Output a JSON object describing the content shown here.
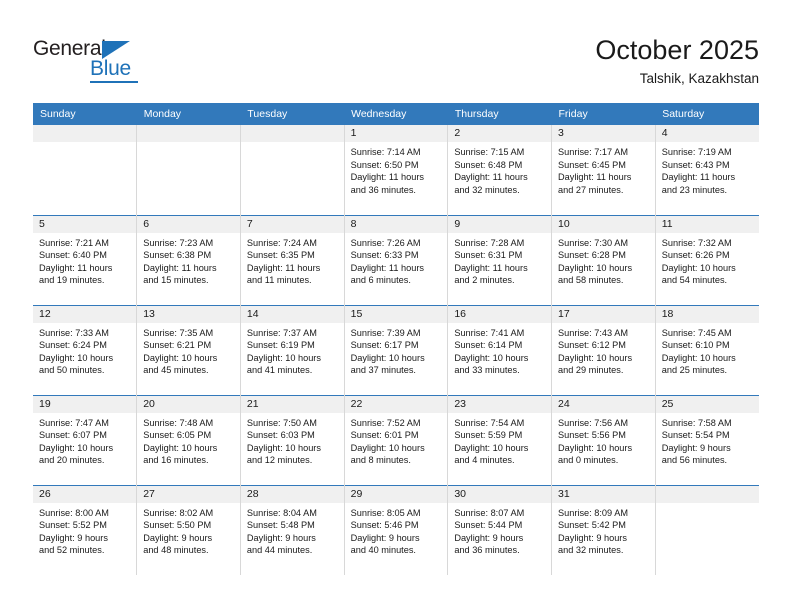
{
  "brand": {
    "name_part1": "General",
    "name_part2": "Blue",
    "accent_color": "#1f72b8"
  },
  "header": {
    "title": "October 2025",
    "subtitle": "Talshik, Kazakhstan",
    "header_bg_color": "#3279bb",
    "daynum_band_color": "#f0f0f0"
  },
  "weekday_headers": [
    "Sunday",
    "Monday",
    "Tuesday",
    "Wednesday",
    "Thursday",
    "Friday",
    "Saturday"
  ],
  "weeks": [
    [
      {
        "day": "",
        "sunrise": "",
        "sunset": "",
        "daylight1": "",
        "daylight2": "",
        "blank": true
      },
      {
        "day": "",
        "sunrise": "",
        "sunset": "",
        "daylight1": "",
        "daylight2": "",
        "blank": true
      },
      {
        "day": "",
        "sunrise": "",
        "sunset": "",
        "daylight1": "",
        "daylight2": "",
        "blank": true
      },
      {
        "day": "1",
        "sunrise": "Sunrise: 7:14 AM",
        "sunset": "Sunset: 6:50 PM",
        "daylight1": "Daylight: 11 hours",
        "daylight2": "and 36 minutes.",
        "blank": false
      },
      {
        "day": "2",
        "sunrise": "Sunrise: 7:15 AM",
        "sunset": "Sunset: 6:48 PM",
        "daylight1": "Daylight: 11 hours",
        "daylight2": "and 32 minutes.",
        "blank": false
      },
      {
        "day": "3",
        "sunrise": "Sunrise: 7:17 AM",
        "sunset": "Sunset: 6:45 PM",
        "daylight1": "Daylight: 11 hours",
        "daylight2": "and 27 minutes.",
        "blank": false
      },
      {
        "day": "4",
        "sunrise": "Sunrise: 7:19 AM",
        "sunset": "Sunset: 6:43 PM",
        "daylight1": "Daylight: 11 hours",
        "daylight2": "and 23 minutes.",
        "blank": false
      }
    ],
    [
      {
        "day": "5",
        "sunrise": "Sunrise: 7:21 AM",
        "sunset": "Sunset: 6:40 PM",
        "daylight1": "Daylight: 11 hours",
        "daylight2": "and 19 minutes.",
        "blank": false
      },
      {
        "day": "6",
        "sunrise": "Sunrise: 7:23 AM",
        "sunset": "Sunset: 6:38 PM",
        "daylight1": "Daylight: 11 hours",
        "daylight2": "and 15 minutes.",
        "blank": false
      },
      {
        "day": "7",
        "sunrise": "Sunrise: 7:24 AM",
        "sunset": "Sunset: 6:35 PM",
        "daylight1": "Daylight: 11 hours",
        "daylight2": "and 11 minutes.",
        "blank": false
      },
      {
        "day": "8",
        "sunrise": "Sunrise: 7:26 AM",
        "sunset": "Sunset: 6:33 PM",
        "daylight1": "Daylight: 11 hours",
        "daylight2": "and 6 minutes.",
        "blank": false
      },
      {
        "day": "9",
        "sunrise": "Sunrise: 7:28 AM",
        "sunset": "Sunset: 6:31 PM",
        "daylight1": "Daylight: 11 hours",
        "daylight2": "and 2 minutes.",
        "blank": false
      },
      {
        "day": "10",
        "sunrise": "Sunrise: 7:30 AM",
        "sunset": "Sunset: 6:28 PM",
        "daylight1": "Daylight: 10 hours",
        "daylight2": "and 58 minutes.",
        "blank": false
      },
      {
        "day": "11",
        "sunrise": "Sunrise: 7:32 AM",
        "sunset": "Sunset: 6:26 PM",
        "daylight1": "Daylight: 10 hours",
        "daylight2": "and 54 minutes.",
        "blank": false
      }
    ],
    [
      {
        "day": "12",
        "sunrise": "Sunrise: 7:33 AM",
        "sunset": "Sunset: 6:24 PM",
        "daylight1": "Daylight: 10 hours",
        "daylight2": "and 50 minutes.",
        "blank": false
      },
      {
        "day": "13",
        "sunrise": "Sunrise: 7:35 AM",
        "sunset": "Sunset: 6:21 PM",
        "daylight1": "Daylight: 10 hours",
        "daylight2": "and 45 minutes.",
        "blank": false
      },
      {
        "day": "14",
        "sunrise": "Sunrise: 7:37 AM",
        "sunset": "Sunset: 6:19 PM",
        "daylight1": "Daylight: 10 hours",
        "daylight2": "and 41 minutes.",
        "blank": false
      },
      {
        "day": "15",
        "sunrise": "Sunrise: 7:39 AM",
        "sunset": "Sunset: 6:17 PM",
        "daylight1": "Daylight: 10 hours",
        "daylight2": "and 37 minutes.",
        "blank": false
      },
      {
        "day": "16",
        "sunrise": "Sunrise: 7:41 AM",
        "sunset": "Sunset: 6:14 PM",
        "daylight1": "Daylight: 10 hours",
        "daylight2": "and 33 minutes.",
        "blank": false
      },
      {
        "day": "17",
        "sunrise": "Sunrise: 7:43 AM",
        "sunset": "Sunset: 6:12 PM",
        "daylight1": "Daylight: 10 hours",
        "daylight2": "and 29 minutes.",
        "blank": false
      },
      {
        "day": "18",
        "sunrise": "Sunrise: 7:45 AM",
        "sunset": "Sunset: 6:10 PM",
        "daylight1": "Daylight: 10 hours",
        "daylight2": "and 25 minutes.",
        "blank": false
      }
    ],
    [
      {
        "day": "19",
        "sunrise": "Sunrise: 7:47 AM",
        "sunset": "Sunset: 6:07 PM",
        "daylight1": "Daylight: 10 hours",
        "daylight2": "and 20 minutes.",
        "blank": false
      },
      {
        "day": "20",
        "sunrise": "Sunrise: 7:48 AM",
        "sunset": "Sunset: 6:05 PM",
        "daylight1": "Daylight: 10 hours",
        "daylight2": "and 16 minutes.",
        "blank": false
      },
      {
        "day": "21",
        "sunrise": "Sunrise: 7:50 AM",
        "sunset": "Sunset: 6:03 PM",
        "daylight1": "Daylight: 10 hours",
        "daylight2": "and 12 minutes.",
        "blank": false
      },
      {
        "day": "22",
        "sunrise": "Sunrise: 7:52 AM",
        "sunset": "Sunset: 6:01 PM",
        "daylight1": "Daylight: 10 hours",
        "daylight2": "and 8 minutes.",
        "blank": false
      },
      {
        "day": "23",
        "sunrise": "Sunrise: 7:54 AM",
        "sunset": "Sunset: 5:59 PM",
        "daylight1": "Daylight: 10 hours",
        "daylight2": "and 4 minutes.",
        "blank": false
      },
      {
        "day": "24",
        "sunrise": "Sunrise: 7:56 AM",
        "sunset": "Sunset: 5:56 PM",
        "daylight1": "Daylight: 10 hours",
        "daylight2": "and 0 minutes.",
        "blank": false
      },
      {
        "day": "25",
        "sunrise": "Sunrise: 7:58 AM",
        "sunset": "Sunset: 5:54 PM",
        "daylight1": "Daylight: 9 hours",
        "daylight2": "and 56 minutes.",
        "blank": false
      }
    ],
    [
      {
        "day": "26",
        "sunrise": "Sunrise: 8:00 AM",
        "sunset": "Sunset: 5:52 PM",
        "daylight1": "Daylight: 9 hours",
        "daylight2": "and 52 minutes.",
        "blank": false
      },
      {
        "day": "27",
        "sunrise": "Sunrise: 8:02 AM",
        "sunset": "Sunset: 5:50 PM",
        "daylight1": "Daylight: 9 hours",
        "daylight2": "and 48 minutes.",
        "blank": false
      },
      {
        "day": "28",
        "sunrise": "Sunrise: 8:04 AM",
        "sunset": "Sunset: 5:48 PM",
        "daylight1": "Daylight: 9 hours",
        "daylight2": "and 44 minutes.",
        "blank": false
      },
      {
        "day": "29",
        "sunrise": "Sunrise: 8:05 AM",
        "sunset": "Sunset: 5:46 PM",
        "daylight1": "Daylight: 9 hours",
        "daylight2": "and 40 minutes.",
        "blank": false
      },
      {
        "day": "30",
        "sunrise": "Sunrise: 8:07 AM",
        "sunset": "Sunset: 5:44 PM",
        "daylight1": "Daylight: 9 hours",
        "daylight2": "and 36 minutes.",
        "blank": false
      },
      {
        "day": "31",
        "sunrise": "Sunrise: 8:09 AM",
        "sunset": "Sunset: 5:42 PM",
        "daylight1": "Daylight: 9 hours",
        "daylight2": "and 32 minutes.",
        "blank": false
      },
      {
        "day": "",
        "sunrise": "",
        "sunset": "",
        "daylight1": "",
        "daylight2": "",
        "blank": true
      }
    ]
  ]
}
